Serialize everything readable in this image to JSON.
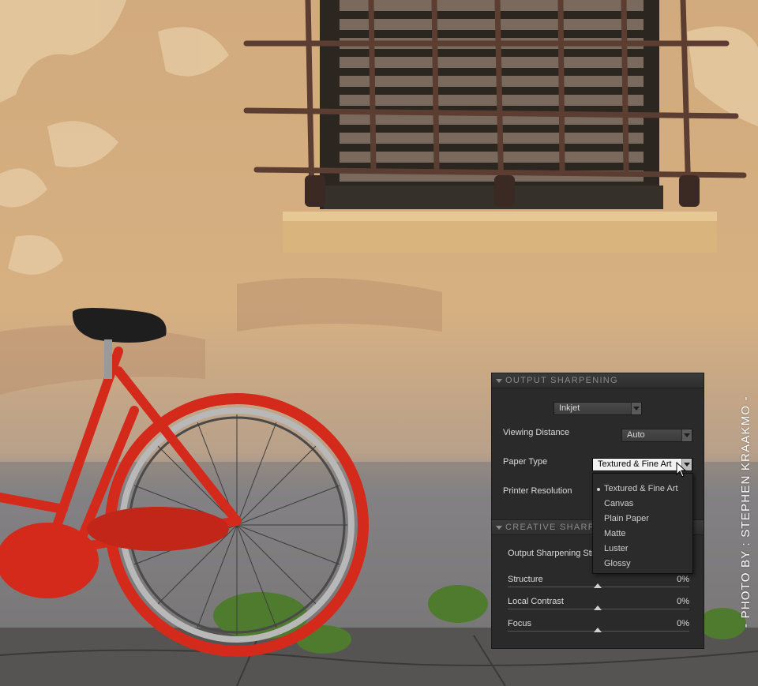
{
  "credit": "- PHOTO BY : STEPHEN KRAAKMO -",
  "panel": {
    "output_sharpening": {
      "title": "OUTPUT SHARPENING",
      "output_type": "Inkjet",
      "viewing_distance_label": "Viewing Distance",
      "viewing_distance_value": "Auto",
      "paper_type_label": "Paper Type",
      "paper_type_value": "Textured & Fine Art",
      "printer_resolution_label": "Printer Resolution"
    },
    "creative_sharpening": {
      "title": "CREATIVE SHARPENING",
      "strength_label": "Output Sharpening Strength",
      "sliders": [
        {
          "label": "Structure",
          "value": "0%"
        },
        {
          "label": "Local Contrast",
          "value": "0%"
        },
        {
          "label": "Focus",
          "value": "0%"
        }
      ]
    }
  },
  "paper_menu": {
    "options": [
      "Textured & Fine Art",
      "Canvas",
      "Plain Paper",
      "Matte",
      "Luster",
      "Glossy"
    ],
    "selected": "Textured & Fine Art"
  },
  "colors": {
    "panel_bg": "#2a2a2a",
    "header_text": "#8a8a8a",
    "bike_red": "#d42a1c",
    "wall": "#c9a47a"
  },
  "icons": [
    "collapse-triangle-icon",
    "dropdown-arrow-icon",
    "slider-thumb-icon",
    "mouse-pointer-icon"
  ]
}
